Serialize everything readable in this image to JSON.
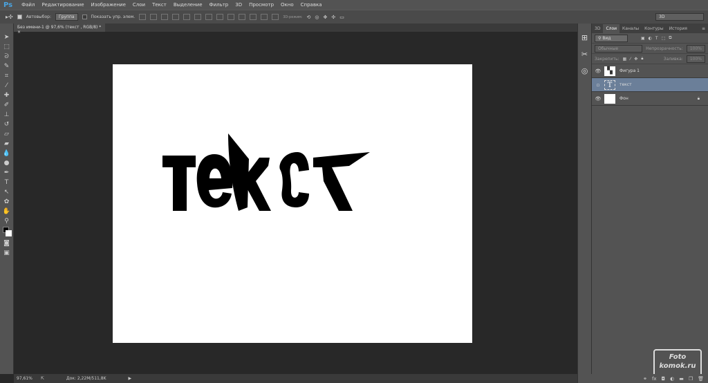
{
  "app": {
    "logo": "Ps"
  },
  "menu": [
    "Файл",
    "Редактирование",
    "Изображение",
    "Слои",
    "Текст",
    "Выделение",
    "Фильтр",
    "3D",
    "Просмотр",
    "Окно",
    "Справка"
  ],
  "options": {
    "autoselect": "Автовыбор:",
    "group": "Группа",
    "show_controls": "Показать упр. элем.",
    "mode3d": "3D-режим:",
    "workspace": "3D"
  },
  "document": {
    "tab": "Без имени-1 @ 97,6% (текст , RGB/8) *",
    "text": "текст"
  },
  "status": {
    "zoom": "97,61%",
    "doc": "Док: 2,22M/511,8K"
  },
  "panel": {
    "tabs": [
      "3D",
      "Слои",
      "Каналы",
      "Контуры",
      "История"
    ],
    "active_tab": "Слои",
    "filter": "Вид",
    "blend": "Обычные",
    "opacity_label": "Непрозрачность:",
    "opacity": "100%",
    "lock_label": "Закрепить:",
    "fill_label": "Заливка:",
    "fill": "100%",
    "layers": [
      {
        "name": "Фигура 1",
        "visible": true
      },
      {
        "name": "текст",
        "visible": false,
        "selected": true
      },
      {
        "name": "Фон",
        "visible": true,
        "locked": true
      }
    ]
  },
  "watermark": {
    "line1": "Foto",
    "line2": "komok.ru"
  }
}
